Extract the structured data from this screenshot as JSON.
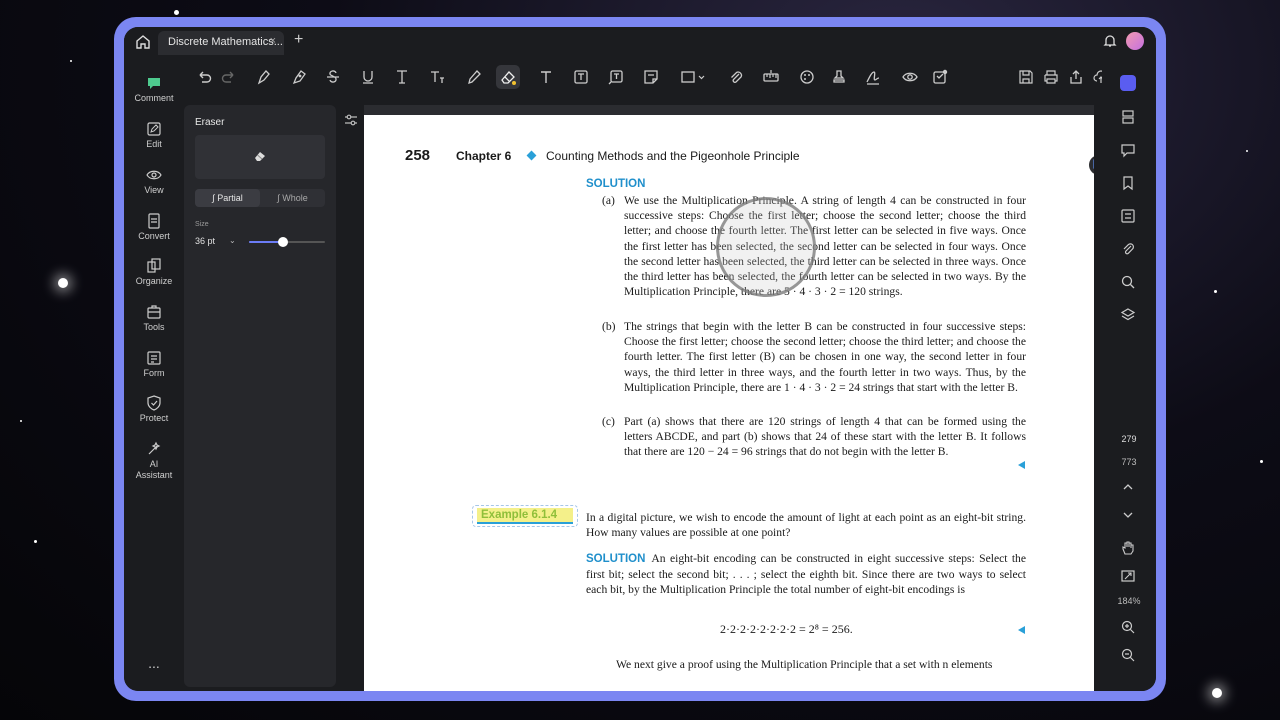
{
  "tab": {
    "title": "Discrete Mathematics...",
    "close": "×",
    "add": "+"
  },
  "sidebar": {
    "items": [
      {
        "label": "Comment",
        "icon": "comment-icon"
      },
      {
        "label": "Edit",
        "icon": "edit-icon"
      },
      {
        "label": "View",
        "icon": "view-icon"
      },
      {
        "label": "Convert",
        "icon": "convert-icon"
      },
      {
        "label": "Organize",
        "icon": "organize-icon"
      },
      {
        "label": "Tools",
        "icon": "tools-icon"
      },
      {
        "label": "Form",
        "icon": "form-icon"
      },
      {
        "label": "Protect",
        "icon": "protect-icon"
      },
      {
        "label": "AI\nAssistant",
        "icon": "ai-assistant-icon"
      }
    ],
    "more": "..."
  },
  "eraser_panel": {
    "title": "Eraser",
    "modes": [
      "Partial",
      "Whole"
    ],
    "selected_mode": "Partial",
    "size_label": "Size",
    "size_value": "36 pt",
    "size_level": 0.45
  },
  "document": {
    "page_number": "258",
    "chapter": "Chapter 6",
    "chapter_title": "Counting Methods and the Pigeonhole Principle",
    "solution_label": "SOLUTION",
    "parts": [
      {
        "label": "(a)",
        "text": "We use the Multiplication Principle. A string of length 4 can be constructed in four successive steps: Choose the first letter; choose the second letter; choose the third letter; and choose the fourth letter. The first letter can be selected in five ways. Once the first letter has been selected, the second letter can be selected in four ways. Once the second letter has been selected, the third letter can be selected in three ways. Once the third letter has been selected, the fourth letter can be selected in two ways. By the Multiplication Principle, there are 5 · 4 · 3 · 2 = 120 strings."
      },
      {
        "label": "(b)",
        "text": "The strings that begin with the letter B can be constructed in four successive steps: Choose the first letter; choose the second letter; choose the third letter; and choose the fourth letter. The first letter (B) can be chosen in one way, the second letter in four ways, the third letter in three ways, and the fourth letter in two ways. Thus, by the Multiplication Principle, there are 1 · 4 · 3 · 2 = 24 strings that start with the letter B."
      },
      {
        "label": "(c)",
        "text": "Part (a) shows that there are 120 strings of length 4 that can be formed using the letters ABCDE, and part (b) shows that 24 of these start with the letter B. It follows that there are 120 − 24 = 96 strings that do not begin with the letter B."
      }
    ],
    "example_label": "Example 6.1.4",
    "example_text": "In a digital picture, we wish to encode the amount of light at each point as an eight-bit string. How many values are possible at one point?",
    "solution2_label": "SOLUTION",
    "solution2_text": "An eight-bit encoding can be constructed in eight successive steps: Select the first bit; select the second bit; . . . ; select the eighth bit. Since there are two ways to select each bit, by the Multiplication Principle the total number of eight-bit encodings is",
    "equation": "2·2·2·2·2·2·2·2 = 2⁸ = 256.",
    "next_text": "We next give a proof using the Multiplication Principle that a set with n elements"
  },
  "right_rail": {
    "current_page": "279",
    "total_pages": "773",
    "zoom": "184%"
  },
  "colors": {
    "accent": "#7b86f2",
    "link_blue": "#1f8fcb",
    "highlight": "#f4f08a"
  }
}
